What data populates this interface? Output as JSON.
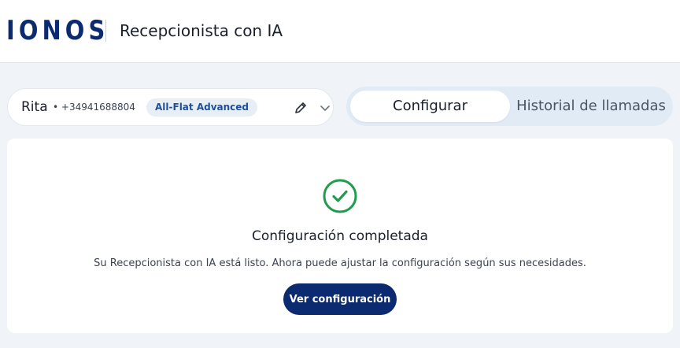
{
  "header": {
    "logo_text": "IONOS",
    "app_title": "Recepcionista con IA"
  },
  "agent": {
    "name": "Rita",
    "phone": "• +34941688804",
    "plan": "All-Flat Advanced",
    "edit_icon": "pencil-icon",
    "dropdown_icon": "chevron-down-icon"
  },
  "tabs": [
    {
      "label": "Configurar",
      "active": true
    },
    {
      "label": "Historial de llamadas",
      "active": false
    }
  ],
  "status": {
    "icon": "check-circle-icon",
    "title": "Configuración completada",
    "description": "Su Recepcionista con IA está listo. Ahora puede ajustar la configuración según sus necesidades.",
    "button_label": "Ver configuración"
  },
  "colors": {
    "brand": "#0b2a6f",
    "success": "#1f9d4c",
    "background": "#f0f4f8",
    "plan_badge_text": "#1f4f9a"
  }
}
